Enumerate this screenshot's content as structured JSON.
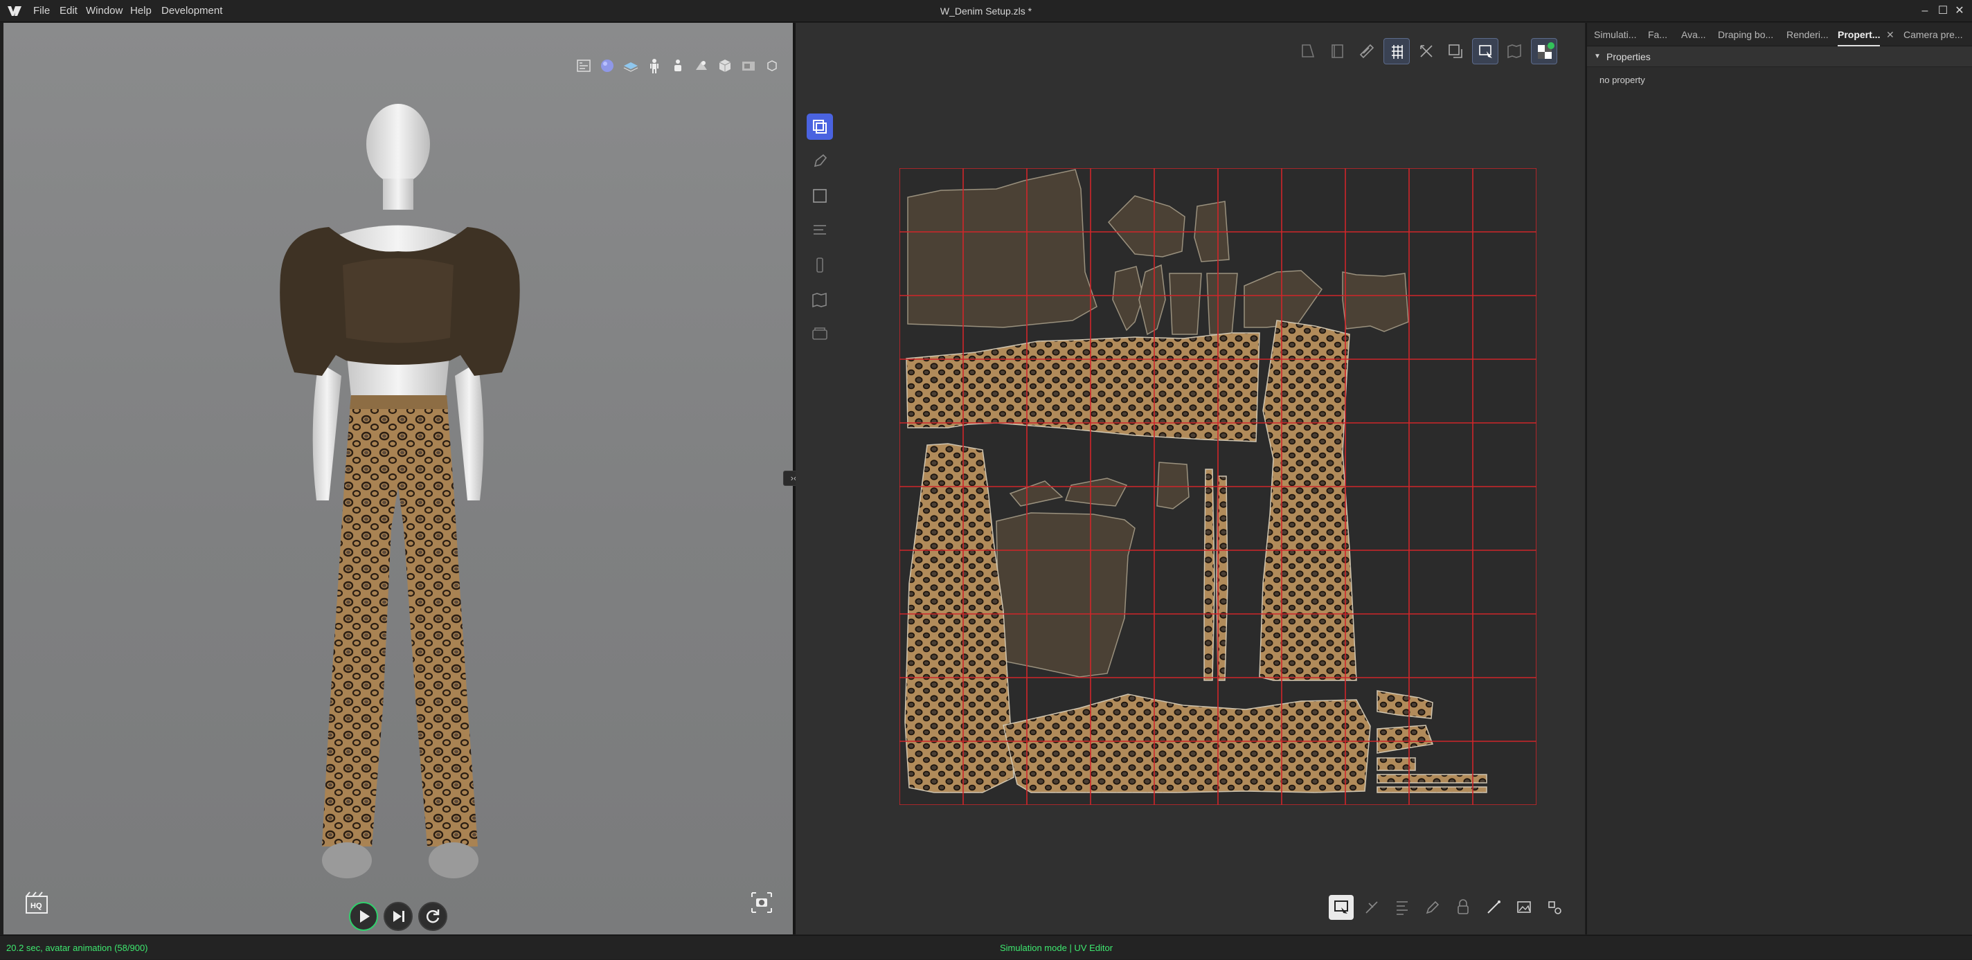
{
  "app": {
    "window_title": "W_Denim Setup.zls *",
    "menu": [
      "File",
      "Edit",
      "Window",
      "Help",
      "Development"
    ]
  },
  "viewport3d": {
    "toolbar_icons": [
      "texture-view-icon",
      "sphere-shading-icon",
      "layer-icon",
      "avatar-icon",
      "avatar-visibility-icon",
      "light-icon",
      "cube-icon",
      "environment-icon",
      "gizmo-icon"
    ],
    "hq_label": "HQ",
    "playback": [
      "play-icon",
      "step-forward-icon",
      "reset-icon"
    ]
  },
  "uv_editor": {
    "top_tools": [
      "transform-uv-icon",
      "edit-uv-icon",
      "sew-uv-icon",
      "grid-snap-icon",
      "scale-uv-icon",
      "pack-icon",
      "select-uv-icon",
      "map-icon",
      "checker-icon"
    ],
    "side_tools": [
      "select-piece-icon",
      "pen-icon",
      "rectangle-icon",
      "ruler-icon",
      "pin-icon",
      "map-icon",
      "texture-icon"
    ],
    "bottom_tools": [
      "display-mode-icon",
      "cut-icon",
      "align-icon",
      "pen-edit-icon",
      "lock-icon",
      "seam-icon",
      "image-icon",
      "settings-icon"
    ],
    "grid": {
      "columns": 10,
      "rows": 10
    }
  },
  "right_panel": {
    "tabs": [
      "Simulati...",
      "Fa...",
      "Ava...",
      "Draping bo...",
      "Renderi...",
      "Propert...",
      "Camera pre..."
    ],
    "active_tab": "Propert...",
    "section_title": "Properties",
    "empty_text": "no property"
  },
  "status": {
    "left": "20.2 sec, avatar animation (58/900)",
    "center": "Simulation mode | UV Editor"
  },
  "colors": {
    "status_green": "#3ee86f",
    "grid_red": "#d0262a",
    "active_blue": "#4a63e0",
    "fabric_dark": "#4b4135",
    "leopard_base": "#b18b5a"
  }
}
